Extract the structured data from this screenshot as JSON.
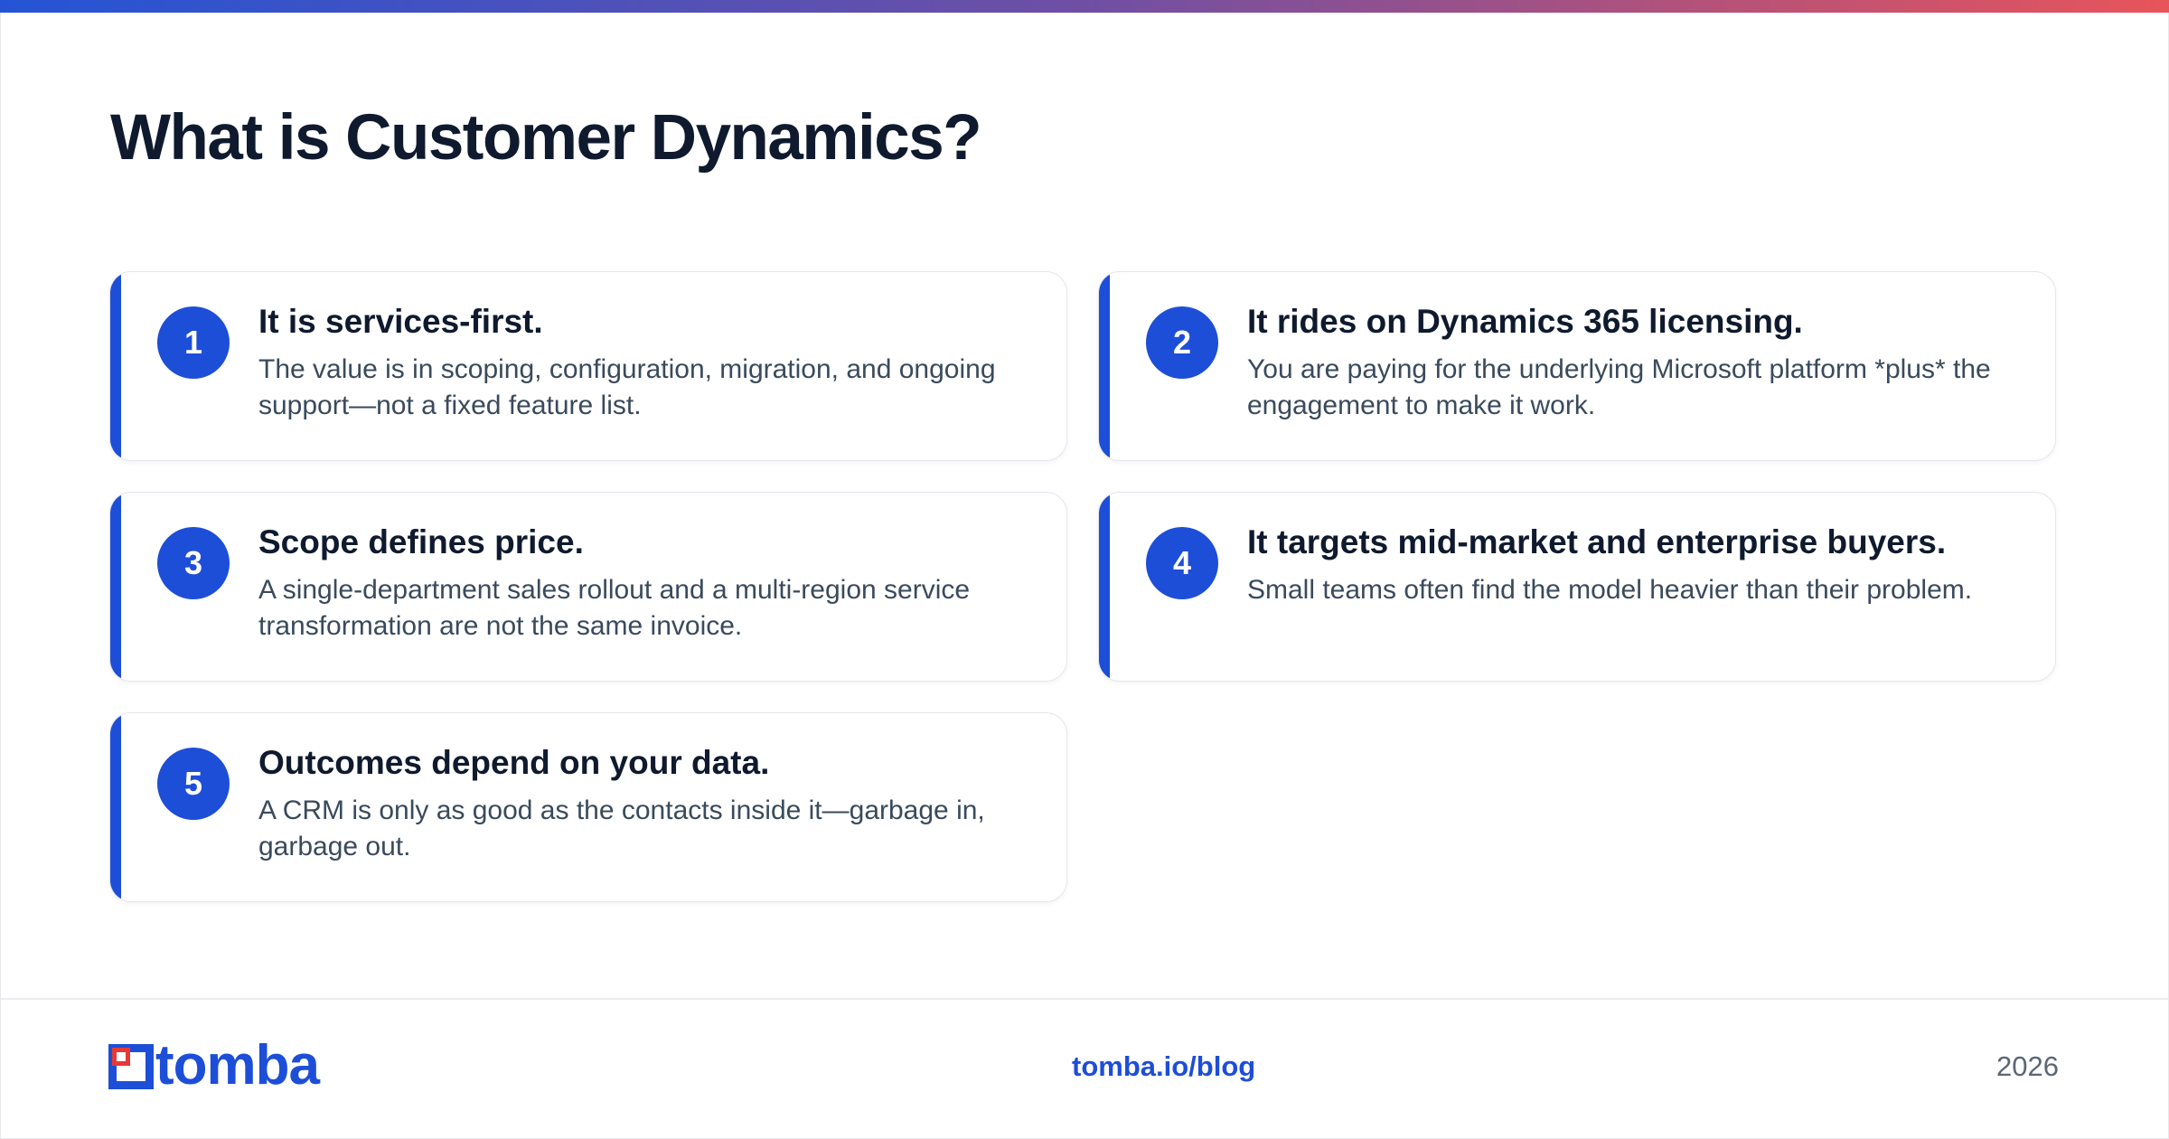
{
  "header": {
    "title": "What is Customer Dynamics?",
    "accent_gradient": [
      "#2454d6",
      "#6f4fa4",
      "#e8545a"
    ]
  },
  "cards": [
    {
      "number": "1",
      "title": "It is services-first.",
      "description": "The value is in scoping, configuration, migration, and ongoing support—not a fixed feature list."
    },
    {
      "number": "2",
      "title": "It rides on Dynamics 365 licensing.",
      "description": "You are paying for the underlying Microsoft platform *plus* the engagement to make it work."
    },
    {
      "number": "3",
      "title": "Scope defines price.",
      "description": "A single-department sales rollout and a multi-region service transformation are not the same invoice."
    },
    {
      "number": "4",
      "title": "It targets mid-market and enterprise buyers.",
      "description": "Small teams often find the model heavier than their problem."
    },
    {
      "number": "5",
      "title": "Outcomes depend on your data.",
      "description": "A CRM is only as good as the contacts inside it—garbage in, garbage out."
    }
  ],
  "footer": {
    "logo_text": "tomba",
    "link": "tomba.io/blog",
    "year": "2026"
  },
  "colors": {
    "accent": "#1d4ed8",
    "logo_red": "#e53935",
    "title": "#0f1a2e",
    "body_text": "#3a4a5c"
  },
  "icons": {
    "logo_mark": "tomba-logo-icon"
  }
}
